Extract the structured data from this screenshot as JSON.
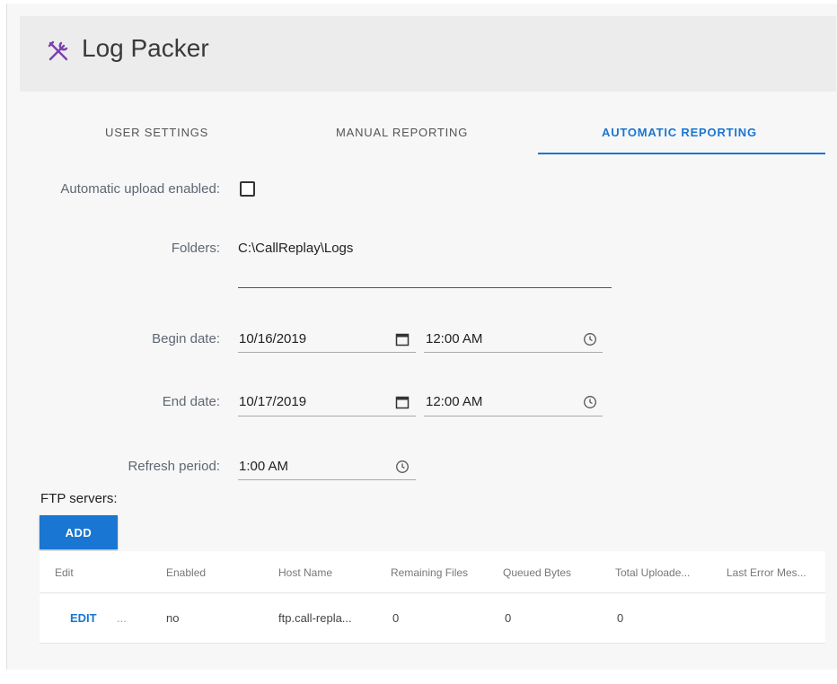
{
  "app": {
    "title": "Log Packer",
    "icon": "tools-icon"
  },
  "tabs": [
    {
      "label": "USER SETTINGS",
      "active": false
    },
    {
      "label": "MANUAL REPORTING",
      "active": false
    },
    {
      "label": "AUTOMATIC REPORTING",
      "active": true
    }
  ],
  "form": {
    "auto_upload_label": "Automatic upload enabled:",
    "auto_upload_checked": false,
    "folders_label": "Folders:",
    "folders_value": "C:\\CallReplay\\Logs",
    "begin_label": "Begin date:",
    "begin_date": "10/16/2019",
    "begin_time": "12:00 AM",
    "end_label": "End date:",
    "end_date": "10/17/2019",
    "end_time": "12:00 AM",
    "refresh_label": "Refresh period:",
    "refresh_value": "1:00 AM"
  },
  "ftp": {
    "label": "FTP servers:",
    "add_label": "ADD",
    "columns": [
      "Edit",
      "Enabled",
      "Host Name",
      "Remaining Files",
      "Queued Bytes",
      "Total Uploade...",
      "Last Error Mes..."
    ],
    "rows": [
      {
        "edit": "EDIT",
        "more": "...",
        "enabled": "no",
        "host": "ftp.call-repla...",
        "remaining": "0",
        "queued": "0",
        "total": "0"
      }
    ]
  },
  "colors": {
    "accent": "#1976d2",
    "header_bg": "#ececec",
    "app_icon": "#7b3fb0"
  }
}
